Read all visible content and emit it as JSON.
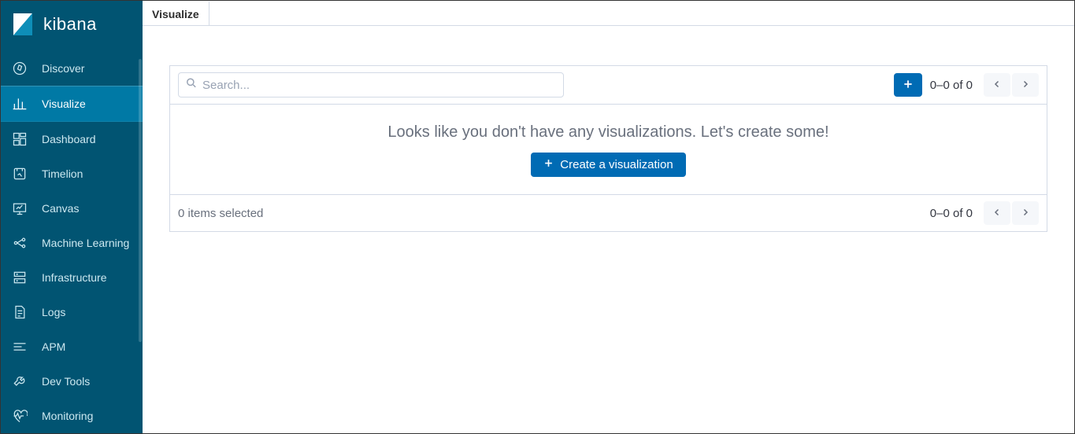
{
  "brand": "kibana",
  "sidebar": {
    "items": [
      {
        "label": "Discover"
      },
      {
        "label": "Visualize"
      },
      {
        "label": "Dashboard"
      },
      {
        "label": "Timelion"
      },
      {
        "label": "Canvas"
      },
      {
        "label": "Machine Learning"
      },
      {
        "label": "Infrastructure"
      },
      {
        "label": "Logs"
      },
      {
        "label": "APM"
      },
      {
        "label": "Dev Tools"
      },
      {
        "label": "Monitoring"
      }
    ]
  },
  "header": {
    "tab": "Visualize"
  },
  "toolbar": {
    "search_placeholder": "Search...",
    "pager_text_top": "0–0 of 0"
  },
  "empty": {
    "title": "Looks like you don't have any visualizations. Let's create some!",
    "create_label": "Create a visualization"
  },
  "footer": {
    "selected_text": "0 items selected",
    "pager_text_bottom": "0–0 of 0"
  }
}
